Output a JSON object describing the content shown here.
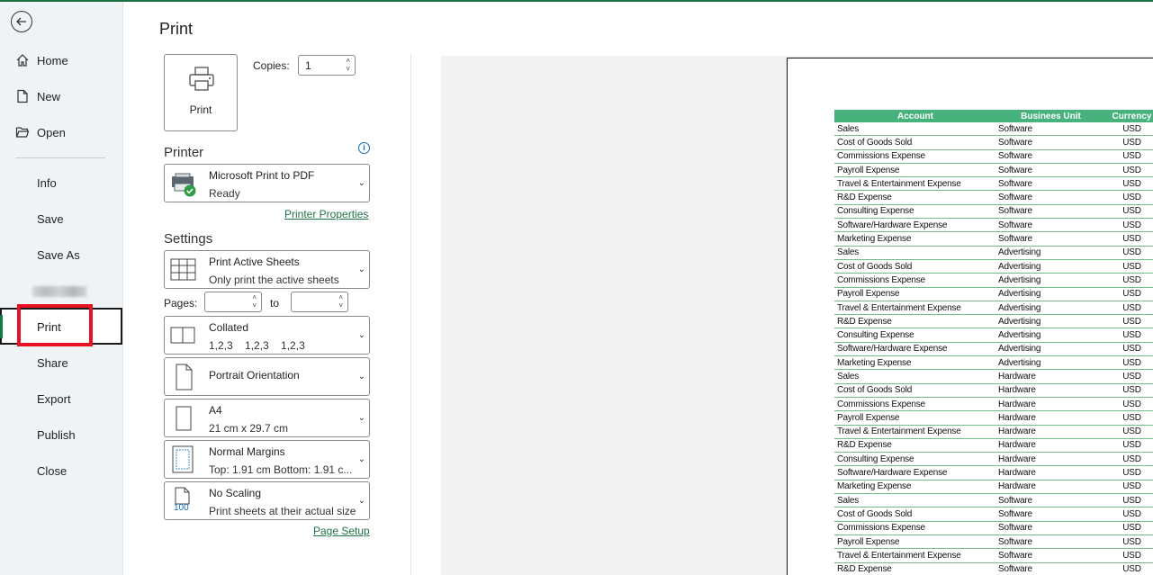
{
  "nav": {
    "items": [
      {
        "label": "Home",
        "icon": "home-icon"
      },
      {
        "label": "New",
        "icon": "new-document-icon"
      },
      {
        "label": "Open",
        "icon": "folder-open-icon"
      },
      {
        "label": "Info"
      },
      {
        "label": "Save"
      },
      {
        "label": "Save As"
      },
      {
        "label": "Print"
      },
      {
        "label": "Share"
      },
      {
        "label": "Export"
      },
      {
        "label": "Publish"
      },
      {
        "label": "Close"
      }
    ]
  },
  "print": {
    "title": "Print",
    "button_label": "Print",
    "copies_label": "Copies:",
    "copies_value": "1",
    "printer_heading": "Printer",
    "printer_name": "Microsoft Print to PDF",
    "printer_status": "Ready",
    "printer_properties": "Printer Properties",
    "settings_heading": "Settings",
    "settings": {
      "sheets": {
        "line1": "Print Active Sheets",
        "line2": "Only print the active sheets"
      },
      "pages_label": "Pages:",
      "pages_to": "to",
      "collation": {
        "line1": "Collated",
        "line2": "1,2,3    1,2,3    1,2,3"
      },
      "orientation": {
        "line1": "Portrait Orientation"
      },
      "paper": {
        "line1": "A4",
        "line2": "21 cm x 29.7 cm"
      },
      "margins": {
        "line1": "Normal Margins",
        "line2": "Top: 1.91 cm Bottom: 1.91 c..."
      },
      "scaling": {
        "line1": "No Scaling",
        "line2": "Print sheets at their actual size",
        "icon_text": "100"
      }
    },
    "page_setup": "Page Setup"
  },
  "colors": {
    "accent": "#107c41",
    "header_fill": "#48b27d",
    "highlight": "#e81123"
  },
  "preview": {
    "columns": [
      "Account",
      "Businees Unit",
      "Currency"
    ],
    "rows": [
      [
        "Sales",
        "Software",
        "USD"
      ],
      [
        "Cost of Goods Sold",
        "Software",
        "USD"
      ],
      [
        "Commissions Expense",
        "Software",
        "USD"
      ],
      [
        "Payroll Expense",
        "Software",
        "USD"
      ],
      [
        "Travel & Entertainment Expense",
        "Software",
        "USD"
      ],
      [
        "R&D Expense",
        "Software",
        "USD"
      ],
      [
        "Consulting Expense",
        "Software",
        "USD"
      ],
      [
        "Software/Hardware Expense",
        "Software",
        "USD"
      ],
      [
        "Marketing Expense",
        "Software",
        "USD"
      ],
      [
        "Sales",
        "Advertising",
        "USD"
      ],
      [
        "Cost of Goods Sold",
        "Advertising",
        "USD"
      ],
      [
        "Commissions Expense",
        "Advertising",
        "USD"
      ],
      [
        "Payroll Expense",
        "Advertising",
        "USD"
      ],
      [
        "Travel & Entertainment Expense",
        "Advertising",
        "USD"
      ],
      [
        "R&D Expense",
        "Advertising",
        "USD"
      ],
      [
        "Consulting Expense",
        "Advertising",
        "USD"
      ],
      [
        "Software/Hardware Expense",
        "Advertising",
        "USD"
      ],
      [
        "Marketing Expense",
        "Advertising",
        "USD"
      ],
      [
        "Sales",
        "Hardware",
        "USD"
      ],
      [
        "Cost of Goods Sold",
        "Hardware",
        "USD"
      ],
      [
        "Commissions Expense",
        "Hardware",
        "USD"
      ],
      [
        "Payroll Expense",
        "Hardware",
        "USD"
      ],
      [
        "Travel & Entertainment Expense",
        "Hardware",
        "USD"
      ],
      [
        "R&D Expense",
        "Hardware",
        "USD"
      ],
      [
        "Consulting Expense",
        "Hardware",
        "USD"
      ],
      [
        "Software/Hardware Expense",
        "Hardware",
        "USD"
      ],
      [
        "Marketing Expense",
        "Hardware",
        "USD"
      ],
      [
        "Sales",
        "Software",
        "USD"
      ],
      [
        "Cost of Goods Sold",
        "Software",
        "USD"
      ],
      [
        "Commissions Expense",
        "Software",
        "USD"
      ],
      [
        "Payroll Expense",
        "Software",
        "USD"
      ],
      [
        "Travel & Entertainment Expense",
        "Software",
        "USD"
      ],
      [
        "R&D Expense",
        "Software",
        "USD"
      ]
    ]
  }
}
